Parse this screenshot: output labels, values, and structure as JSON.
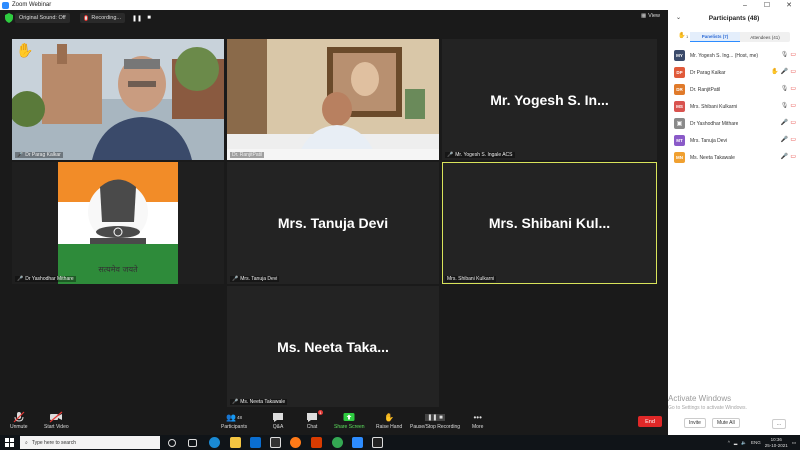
{
  "window": {
    "title": "Zoom Webinar"
  },
  "topbar": {
    "sound_label": "Original Sound: Off",
    "recording_label": "Recording...",
    "view_label": "View"
  },
  "tiles": [
    {
      "name": "Dr Parag Kalkar",
      "big": ""
    },
    {
      "name": "Dr. RanjitPatil",
      "big": ""
    },
    {
      "name": "Mr. Yogesh S. Ingale ACS",
      "big": "Mr. Yogesh S. In..."
    },
    {
      "name": "Dr Yashodhar Mithare",
      "big": ""
    },
    {
      "name": "Mrs. Tanuja Devi",
      "big": "Mrs. Tanuja Devi"
    },
    {
      "name": "Mrs. Shibani Kulkarni",
      "big": "Mrs. Shibani Kul..."
    },
    {
      "name": "Ms. Neeta Takawale",
      "big": "Ms. Neeta Taka..."
    }
  ],
  "emblem_motto": "सत्यमेव जयते",
  "toolbar": {
    "unmute": "Unmute",
    "start_video": "Start Video",
    "participants": "Participants",
    "participants_count": "48",
    "qa": "Q&A",
    "chat": "Chat",
    "chat_badge": "1",
    "share": "Share Screen",
    "raise_hand": "Raise Hand",
    "pause_rec": "Pause/Stop Recording",
    "more": "More",
    "end": "End"
  },
  "panel": {
    "title": "Participants (48)",
    "hand_count": "1",
    "tab_panelists": "Panelists (7)",
    "tab_attendees": "Attendees (41)",
    "participants": [
      {
        "initials": "MY",
        "name": "Mr. Yogesh S. Ing...  (Host, me)",
        "color": "#3a4a6a",
        "icons": "mic-video"
      },
      {
        "initials": "DP",
        "name": "Dr Parag Kalkar",
        "color": "#e05a3a",
        "icons": "hand-mute-video"
      },
      {
        "initials": "DR",
        "name": "Dr. RanjitPatil",
        "color": "#e07a2a",
        "icons": "mic-video"
      },
      {
        "initials": "MS",
        "name": "Mrs. Shibani Kulkarni",
        "color": "#d9534f",
        "icons": "mic-video"
      },
      {
        "initials": "",
        "name": "Dr Yashodhar Mithare",
        "color": "#8a8a8a",
        "icons": "mute-video"
      },
      {
        "initials": "MT",
        "name": "Mrs. Tanuja Devi",
        "color": "#8a5ac8",
        "icons": "mute-video"
      },
      {
        "initials": "MN",
        "name": "Ms. Neeta Takawale",
        "color": "#f0a030",
        "icons": "mute-video"
      }
    ],
    "activate_title": "Activate Windows",
    "activate_sub": "Go to Settings to activate Windows.",
    "invite": "Invite",
    "mute_all": "Mute All",
    "more": "..."
  },
  "taskbar": {
    "search_placeholder": "Type here to search",
    "lang": "ENG",
    "time": "10:36",
    "date": "25-10-2021"
  }
}
